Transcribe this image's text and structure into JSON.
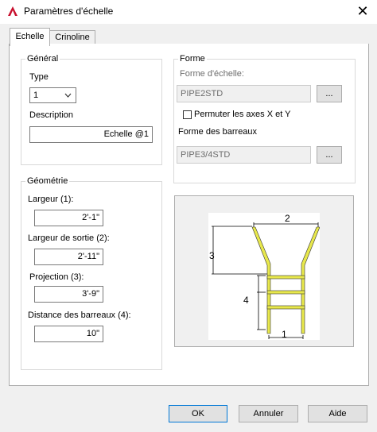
{
  "window": {
    "title": "Paramètres d'échelle",
    "close_glyph": "✕"
  },
  "tabs": [
    {
      "label": "Echelle",
      "active": true
    },
    {
      "label": "Crinoline",
      "active": false
    }
  ],
  "general": {
    "legend": "Général",
    "type_label": "Type",
    "type_value": "1",
    "description_label": "Description",
    "description_value": "Echelle @1"
  },
  "forme": {
    "legend": "Forme",
    "forme_echelle_label": "Forme d'échelle:",
    "forme_echelle_value": "PIPE2STD",
    "browse_label": "...",
    "permuter_label": "Permuter les axes X et Y",
    "permuter_checked": false,
    "forme_barreaux_label": "Forme des barreaux",
    "forme_barreaux_value": "PIPE3/4STD"
  },
  "geometrie": {
    "legend": "Géométrie",
    "largeur_label": "Largeur (1):",
    "largeur_value": "2'-1\"",
    "largeur_sortie_label": "Largeur de sortie (2):",
    "largeur_sortie_value": "2'-11\"",
    "projection_label": "Projection (3):",
    "projection_value": "3'-9\"",
    "distance_label": "Distance des barreaux (4):",
    "distance_value": "10\""
  },
  "diagram": {
    "label_1": "1",
    "label_2": "2",
    "label_3": "3",
    "label_4": "4"
  },
  "buttons": {
    "ok": "OK",
    "annuler": "Annuler",
    "aide": "Aide"
  },
  "colors": {
    "accent": "#0078d7",
    "ladder": "#e8e84c",
    "app_icon": "#c8102e"
  }
}
